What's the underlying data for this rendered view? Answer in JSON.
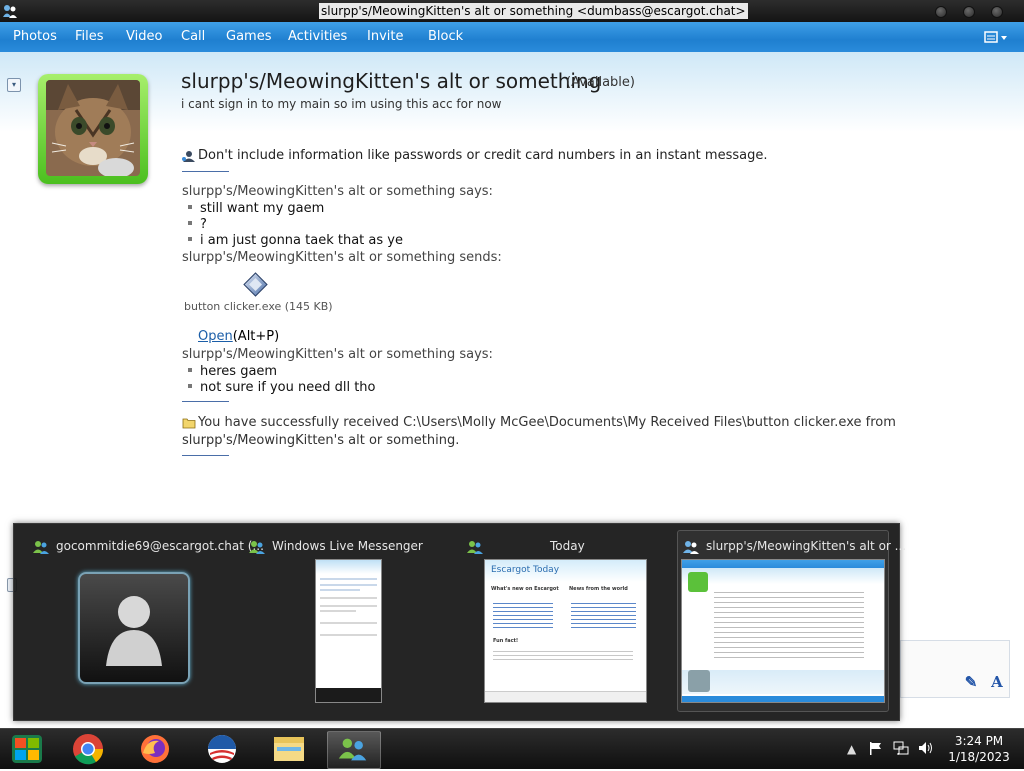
{
  "window": {
    "title": "slurpp's/MeowingKitten's alt or something <dumbass@escargot.chat>"
  },
  "menu": {
    "items": [
      "Photos",
      "Files",
      "Video",
      "Call",
      "Games",
      "Activities",
      "Invite",
      "Block"
    ]
  },
  "contact": {
    "name": "slurpp's/MeowingKitten's alt or something",
    "status": "(Available)",
    "personal_message": "i cant sign in to my main so im using this acc for now"
  },
  "conversation": {
    "warning": "Don't include information like passwords or credit card numbers in an instant message.",
    "says_1": "slurpp's/MeowingKitten's alt or something says:",
    "messages_1": [
      "still want my gaem",
      "?",
      "i am just gonna taek that as ye"
    ],
    "sends": "slurpp's/MeowingKitten's alt or something sends:",
    "file_name": "button clicker.exe (145 KB)",
    "open_link": "Open",
    "open_shortcut": "(Alt+P)",
    "says_2": "slurpp's/MeowingKitten's alt or something says:",
    "messages_2": [
      "heres gaem",
      "not sure if you need dll tho"
    ],
    "received_line1": "You have successfully received C:\\Users\\Molly McGee\\Documents\\My Received Files\\button clicker.exe from",
    "received_line2": "slurpp's/MeowingKitten's alt or something."
  },
  "switcher": {
    "items": [
      {
        "title": "gocommitdie69@escargot.chat (..."
      },
      {
        "title": "Windows Live Messenger"
      },
      {
        "title": "Today"
      },
      {
        "title": "slurpp's/MeowingKitten's alt or ..."
      }
    ],
    "today_brand": "Escargot Today",
    "today_heading_1": "What's new on Escargot",
    "today_heading_2": "News from the world",
    "today_fun_fact": "Fun fact!"
  },
  "taskbar": {
    "time": "3:24 PM",
    "date": "1/18/2023"
  },
  "colors": {
    "menubar": "#2a8bdb",
    "avatar_frame": "#4bbf1f",
    "link": "#1b5ea8",
    "switcher_bg": "#141414"
  }
}
